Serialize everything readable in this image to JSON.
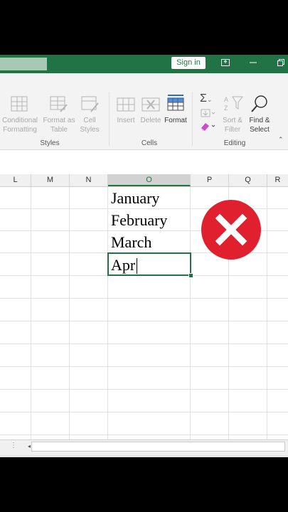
{
  "titlebar": {
    "sign_in_label": "Sign in"
  },
  "ribbon": {
    "styles": {
      "conditional_line1": "Conditional",
      "conditional_line2": "Formatting",
      "format_as_table_line1": "Format as",
      "format_as_table_line2": "Table",
      "cell_styles_line1": "Cell",
      "cell_styles_line2": "Styles",
      "group_label": "Styles"
    },
    "cells": {
      "insert_label": "Insert",
      "delete_label": "Delete",
      "format_label": "Format",
      "group_label": "Cells"
    },
    "editing": {
      "sort_filter_line1": "Sort &",
      "sort_filter_line2": "Filter",
      "find_select_line1": "Find &",
      "find_select_line2": "Select",
      "group_label": "Editing"
    }
  },
  "columns": [
    "L",
    "M",
    "N",
    "O",
    "P",
    "Q",
    "R"
  ],
  "selected_column": "O",
  "cells": {
    "o1": "January",
    "o2": "February",
    "o3": "March",
    "o4_editing": "Apr"
  },
  "overlay": {
    "icon": "error-x-icon",
    "color": "#e0202f"
  },
  "colors": {
    "accent": "#217346"
  }
}
